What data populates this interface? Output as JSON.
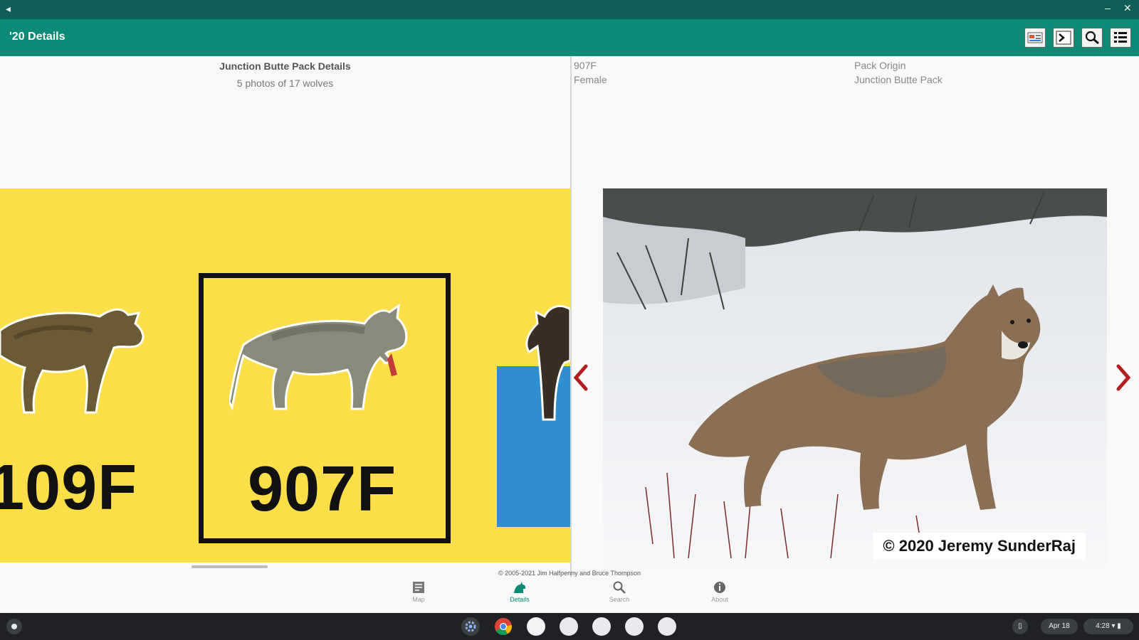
{
  "window": {
    "back_glyph": "◂",
    "minimize_glyph": "–",
    "close_glyph": "✕"
  },
  "appbar": {
    "title": "'20 Details",
    "actions": [
      {
        "icon": "pack-card-icon"
      },
      {
        "icon": "terminal-icon"
      },
      {
        "icon": "zoom-icon"
      },
      {
        "icon": "list-icon"
      }
    ]
  },
  "pack": {
    "title": "Junction Butte Pack Details",
    "subtitle": "5 photos of 17 wolves",
    "cards": [
      "109F",
      "907F"
    ]
  },
  "wolf": {
    "id": "907F",
    "sex": "Female",
    "origin_label": "Pack Origin",
    "origin_value": "Junction Butte Pack",
    "photo_credit": "© 2020 Jeremy SunderRaj"
  },
  "footer": {
    "copyright": "© 2005-2021 Jim Halfpenny and Bruce Thompson"
  },
  "bottom_nav": [
    {
      "label": "Map",
      "icon": "map-icon"
    },
    {
      "label": "Details",
      "icon": "wolf-icon",
      "active": true
    },
    {
      "label": "Search",
      "icon": "search-icon"
    },
    {
      "label": "About",
      "icon": "info-icon"
    }
  ],
  "shelf": {
    "date": "Apr 18",
    "time": "4:28",
    "accent": "#0b8a76",
    "titlebar": "#0e5e56",
    "strip_color": "#fbde48"
  }
}
